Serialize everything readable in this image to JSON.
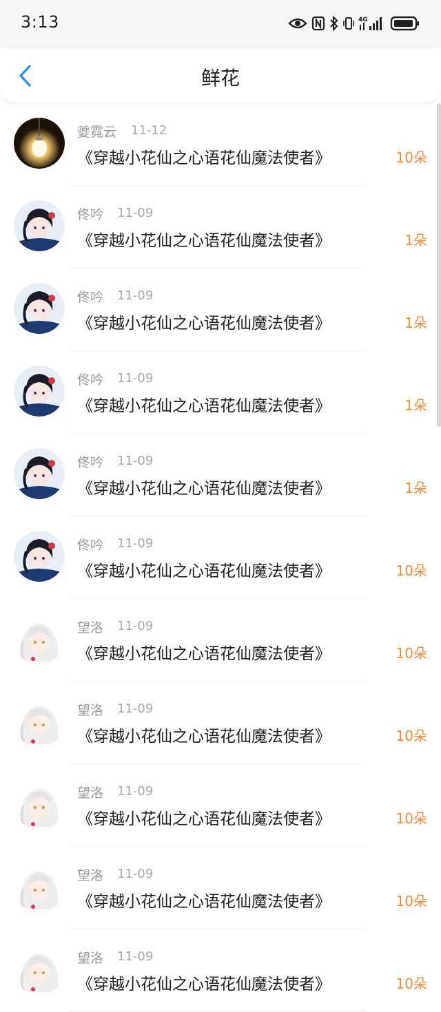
{
  "status_bar": {
    "time": "3:13",
    "icons": [
      "eye-icon",
      "nfc-icon",
      "bluetooth-icon",
      "vibrate-icon",
      "signal-4g-icon",
      "battery-icon"
    ],
    "network_label": "4G"
  },
  "header": {
    "title": "鲜花",
    "back_icon": "chevron-left-icon",
    "accent_color": "#2e8ff0"
  },
  "count_color": "#f08a3c",
  "rows": [
    {
      "name": "夔霓云",
      "date": "11-12",
      "title": "《穿越小花仙之心语花仙魔法使者》",
      "count": "10朵",
      "avatar": "lightbulb"
    },
    {
      "name": "佟吟",
      "date": "11-09",
      "title": "《穿越小花仙之心语花仙魔法使者》",
      "count": "1朵",
      "avatar": "dark-hair-girl"
    },
    {
      "name": "佟吟",
      "date": "11-09",
      "title": "《穿越小花仙之心语花仙魔法使者》",
      "count": "1朵",
      "avatar": "dark-hair-girl"
    },
    {
      "name": "佟吟",
      "date": "11-09",
      "title": "《穿越小花仙之心语花仙魔法使者》",
      "count": "1朵",
      "avatar": "dark-hair-girl"
    },
    {
      "name": "佟吟",
      "date": "11-09",
      "title": "《穿越小花仙之心语花仙魔法使者》",
      "count": "1朵",
      "avatar": "dark-hair-girl"
    },
    {
      "name": "佟吟",
      "date": "11-09",
      "title": "《穿越小花仙之心语花仙魔法使者》",
      "count": "10朵",
      "avatar": "dark-hair-girl"
    },
    {
      "name": "望洛",
      "date": "11-09",
      "title": "《穿越小花仙之心语花仙魔法使者》",
      "count": "10朵",
      "avatar": "white-hair-girl"
    },
    {
      "name": "望洛",
      "date": "11-09",
      "title": "《穿越小花仙之心语花仙魔法使者》",
      "count": "10朵",
      "avatar": "white-hair-girl"
    },
    {
      "name": "望洛",
      "date": "11-09",
      "title": "《穿越小花仙之心语花仙魔法使者》",
      "count": "10朵",
      "avatar": "white-hair-girl"
    },
    {
      "name": "望洛",
      "date": "11-09",
      "title": "《穿越小花仙之心语花仙魔法使者》",
      "count": "10朵",
      "avatar": "white-hair-girl"
    },
    {
      "name": "望洛",
      "date": "11-09",
      "title": "《穿越小花仙之心语花仙魔法使者》",
      "count": "10朵",
      "avatar": "white-hair-girl"
    }
  ]
}
